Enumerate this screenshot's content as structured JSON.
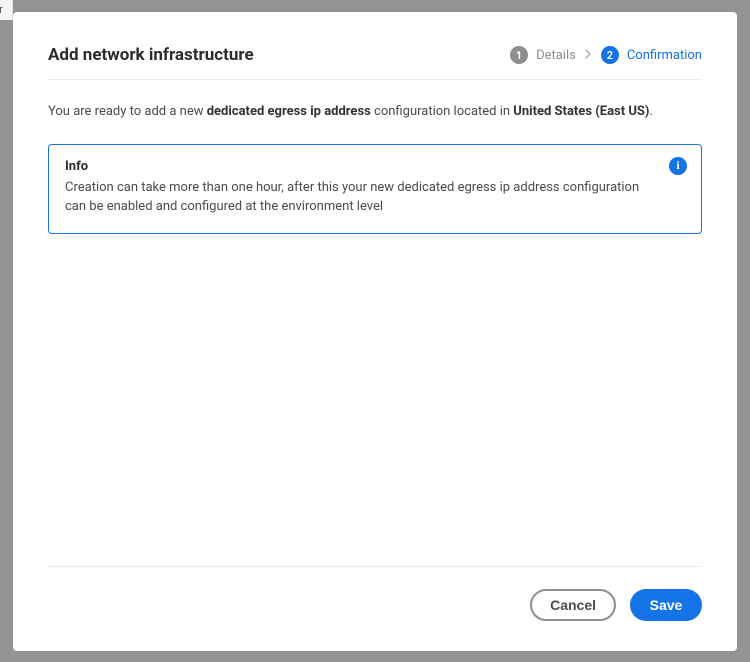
{
  "background": {
    "sidebar_fragment": "ver"
  },
  "modal": {
    "title": "Add network infrastructure",
    "stepper": {
      "step1": {
        "num": "1",
        "label": "Details"
      },
      "step2": {
        "num": "2",
        "label": "Confirmation"
      }
    },
    "intro": {
      "prefix": "You are ready to add a new ",
      "bold1": "dedicated egress ip address",
      "mid": " configuration located in ",
      "bold2": "United States (East US)",
      "suffix": "."
    },
    "info": {
      "title": "Info",
      "text": "Creation can take more than one hour, after this your new dedicated egress ip address configuration can be enabled and configured at the environment level"
    },
    "buttons": {
      "cancel": "Cancel",
      "save": "Save"
    }
  }
}
